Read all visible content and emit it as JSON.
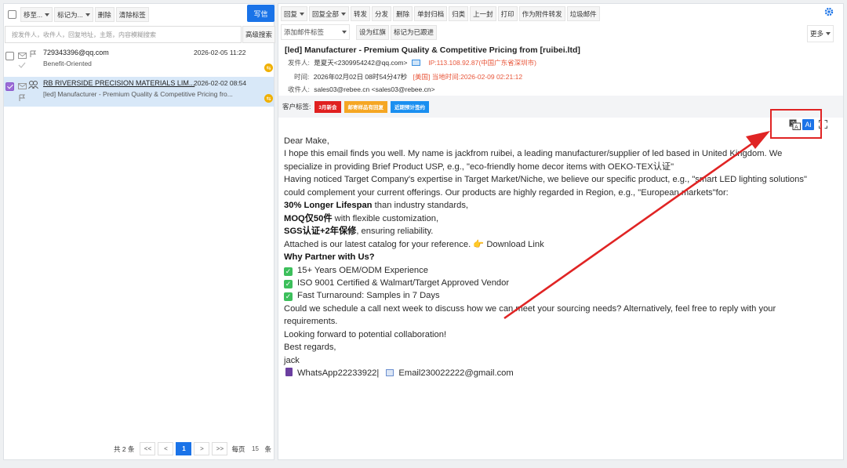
{
  "left_toolbar": {
    "move_to": "移至...",
    "mark_as": "标记为...",
    "delete": "删除",
    "clear_tags": "清除标签",
    "compose": "写信"
  },
  "search": {
    "placeholder": "按发件人，收件人，回复地址，主题，内容模糊搜索",
    "advanced": "高级搜索"
  },
  "mail_list": [
    {
      "sender": "729343396@qq.com",
      "date": "2026-02-05 11:22",
      "preview": "Benefit-Oriented"
    },
    {
      "sender": "RB RIVERSIDE PRECISION MATERIALS LIM...",
      "date": "2026-02-02 08:54",
      "preview": "[led] Manufacturer - Premium Quality & Competitive Pricing fro..."
    }
  ],
  "pager": {
    "total": "共 2 条",
    "first": "<<",
    "prev": "<",
    "current": "1",
    "next": ">",
    "last": ">>",
    "per_page_label": "每页",
    "per_page": "15",
    "unit": "条"
  },
  "right_toolbar": {
    "reply": "回复",
    "reply_all": "回复全部",
    "forward": "转发",
    "distribute": "分发",
    "delete": "删除",
    "single_archive": "单封归档",
    "classify": "归类",
    "previous": "上一封",
    "print": "打印",
    "forward_attachment": "作为附件转发",
    "spam": "垃圾邮件",
    "add_tag": "添加邮件标签",
    "set_red_flag": "设为红旗",
    "mark_followed": "标记为已跟进",
    "more": "更多"
  },
  "email": {
    "subject": "[led] Manufacturer - Premium Quality & Competitive Pricing from [ruibei.ltd]",
    "from_label": "发件人:",
    "from": "是夏天<2309954242@qq.com>",
    "ip": "IP:113.108.92.87(中国广东省深圳市)",
    "time_label": "时间:",
    "time": "2026年02月02日 08时54分47秒",
    "local_time": "[美国] 当地时间:2026-02-09 02:21:12",
    "to_label": "收件人:",
    "to": "sales03@rebee.cn <sales03@rebee.cn>",
    "customer_tags_label": "客户标签:",
    "tags": [
      {
        "text": "3月新会",
        "color": "#e02020"
      },
      {
        "text": "邮寄样品有回复",
        "color": "#f5a623"
      },
      {
        "text": "近期预计签约",
        "color": "#1a8ff0"
      }
    ]
  },
  "body": {
    "l1": "Dear Make,",
    "l2": "I hope this email finds you well. My name is jackfrom ruibei, a leading manufacturer/supplier of led based in United Kingdom. We",
    "l3": "specialize in providing Brief Product USP, e.g., \"eco-friendly home decor items with OEKO-TEX认证\"",
    "l4": "Having noticed Target Company's expertise in Target Market/Niche, we believe our specific product, e.g., \"smart LED lighting solutions\"",
    "l5": "could complement your current offerings. Our products are highly regarded in Region, e.g., \"European markets\"for:",
    "l6b": "30% Longer Lifespan",
    "l6": " than industry standards,",
    "l7b": "MOQ仅50件",
    "l7": " with flexible customization,",
    "l8b": "SGS认证+2年保修",
    "l8": ", ensuring reliability.",
    "l9": "Attached is our latest catalog for your reference. 👉 Download Link",
    "l10": "Why Partner with Us?",
    "l11": "15+ Years OEM/ODM Experience",
    "l12": "ISO 9001 Certified & Walmart/Target Approved Vendor",
    "l13": "Fast Turnaround: Samples in 7 Days",
    "l14": "Could we schedule a call next week to discuss how we can meet your sourcing needs? Alternatively, feel free to reply with your",
    "l15": "requirements.",
    "l16": "Looking forward to potential collaboration!",
    "l17": "Best regards,",
    "l18": "jack",
    "l19": "WhatsApp22233922|",
    "l20": "Email230022222@gmail.com"
  },
  "ai_button": "Ai",
  "colors": {
    "accent": "#1a73e8",
    "annotation": "#e02424",
    "selected_row": "#d8e8f8"
  }
}
